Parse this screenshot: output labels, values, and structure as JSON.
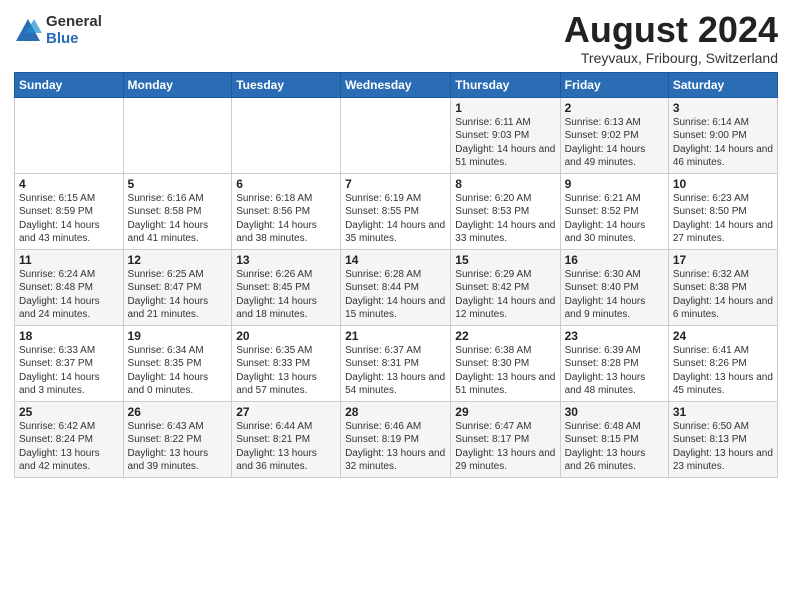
{
  "logo": {
    "general": "General",
    "blue": "Blue"
  },
  "title": "August 2024",
  "location": "Treyvaux, Fribourg, Switzerland",
  "days_header": [
    "Sunday",
    "Monday",
    "Tuesday",
    "Wednesday",
    "Thursday",
    "Friday",
    "Saturday"
  ],
  "weeks": [
    [
      {
        "day": "",
        "info": ""
      },
      {
        "day": "",
        "info": ""
      },
      {
        "day": "",
        "info": ""
      },
      {
        "day": "",
        "info": ""
      },
      {
        "day": "1",
        "info": "Sunrise: 6:11 AM\nSunset: 9:03 PM\nDaylight: 14 hours and 51 minutes."
      },
      {
        "day": "2",
        "info": "Sunrise: 6:13 AM\nSunset: 9:02 PM\nDaylight: 14 hours and 49 minutes."
      },
      {
        "day": "3",
        "info": "Sunrise: 6:14 AM\nSunset: 9:00 PM\nDaylight: 14 hours and 46 minutes."
      }
    ],
    [
      {
        "day": "4",
        "info": "Sunrise: 6:15 AM\nSunset: 8:59 PM\nDaylight: 14 hours and 43 minutes."
      },
      {
        "day": "5",
        "info": "Sunrise: 6:16 AM\nSunset: 8:58 PM\nDaylight: 14 hours and 41 minutes."
      },
      {
        "day": "6",
        "info": "Sunrise: 6:18 AM\nSunset: 8:56 PM\nDaylight: 14 hours and 38 minutes."
      },
      {
        "day": "7",
        "info": "Sunrise: 6:19 AM\nSunset: 8:55 PM\nDaylight: 14 hours and 35 minutes."
      },
      {
        "day": "8",
        "info": "Sunrise: 6:20 AM\nSunset: 8:53 PM\nDaylight: 14 hours and 33 minutes."
      },
      {
        "day": "9",
        "info": "Sunrise: 6:21 AM\nSunset: 8:52 PM\nDaylight: 14 hours and 30 minutes."
      },
      {
        "day": "10",
        "info": "Sunrise: 6:23 AM\nSunset: 8:50 PM\nDaylight: 14 hours and 27 minutes."
      }
    ],
    [
      {
        "day": "11",
        "info": "Sunrise: 6:24 AM\nSunset: 8:48 PM\nDaylight: 14 hours and 24 minutes."
      },
      {
        "day": "12",
        "info": "Sunrise: 6:25 AM\nSunset: 8:47 PM\nDaylight: 14 hours and 21 minutes."
      },
      {
        "day": "13",
        "info": "Sunrise: 6:26 AM\nSunset: 8:45 PM\nDaylight: 14 hours and 18 minutes."
      },
      {
        "day": "14",
        "info": "Sunrise: 6:28 AM\nSunset: 8:44 PM\nDaylight: 14 hours and 15 minutes."
      },
      {
        "day": "15",
        "info": "Sunrise: 6:29 AM\nSunset: 8:42 PM\nDaylight: 14 hours and 12 minutes."
      },
      {
        "day": "16",
        "info": "Sunrise: 6:30 AM\nSunset: 8:40 PM\nDaylight: 14 hours and 9 minutes."
      },
      {
        "day": "17",
        "info": "Sunrise: 6:32 AM\nSunset: 8:38 PM\nDaylight: 14 hours and 6 minutes."
      }
    ],
    [
      {
        "day": "18",
        "info": "Sunrise: 6:33 AM\nSunset: 8:37 PM\nDaylight: 14 hours and 3 minutes."
      },
      {
        "day": "19",
        "info": "Sunrise: 6:34 AM\nSunset: 8:35 PM\nDaylight: 14 hours and 0 minutes."
      },
      {
        "day": "20",
        "info": "Sunrise: 6:35 AM\nSunset: 8:33 PM\nDaylight: 13 hours and 57 minutes."
      },
      {
        "day": "21",
        "info": "Sunrise: 6:37 AM\nSunset: 8:31 PM\nDaylight: 13 hours and 54 minutes."
      },
      {
        "day": "22",
        "info": "Sunrise: 6:38 AM\nSunset: 8:30 PM\nDaylight: 13 hours and 51 minutes."
      },
      {
        "day": "23",
        "info": "Sunrise: 6:39 AM\nSunset: 8:28 PM\nDaylight: 13 hours and 48 minutes."
      },
      {
        "day": "24",
        "info": "Sunrise: 6:41 AM\nSunset: 8:26 PM\nDaylight: 13 hours and 45 minutes."
      }
    ],
    [
      {
        "day": "25",
        "info": "Sunrise: 6:42 AM\nSunset: 8:24 PM\nDaylight: 13 hours and 42 minutes."
      },
      {
        "day": "26",
        "info": "Sunrise: 6:43 AM\nSunset: 8:22 PM\nDaylight: 13 hours and 39 minutes."
      },
      {
        "day": "27",
        "info": "Sunrise: 6:44 AM\nSunset: 8:21 PM\nDaylight: 13 hours and 36 minutes."
      },
      {
        "day": "28",
        "info": "Sunrise: 6:46 AM\nSunset: 8:19 PM\nDaylight: 13 hours and 32 minutes."
      },
      {
        "day": "29",
        "info": "Sunrise: 6:47 AM\nSunset: 8:17 PM\nDaylight: 13 hours and 29 minutes."
      },
      {
        "day": "30",
        "info": "Sunrise: 6:48 AM\nSunset: 8:15 PM\nDaylight: 13 hours and 26 minutes."
      },
      {
        "day": "31",
        "info": "Sunrise: 6:50 AM\nSunset: 8:13 PM\nDaylight: 13 hours and 23 minutes."
      }
    ]
  ]
}
